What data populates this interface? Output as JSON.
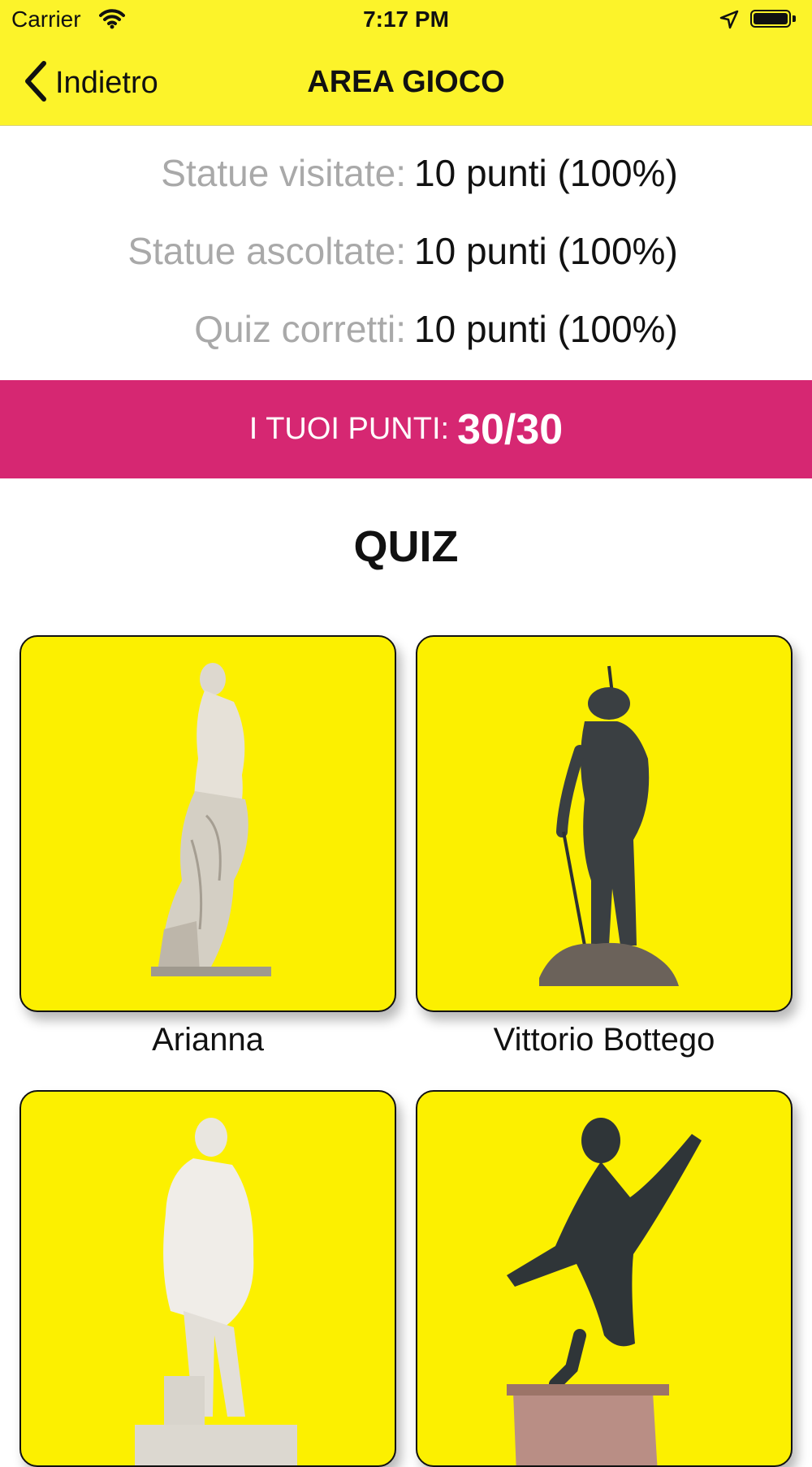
{
  "status_bar": {
    "carrier": "Carrier",
    "time": "7:17 PM"
  },
  "nav": {
    "back_label": "Indietro",
    "title": "AREA GIOCO"
  },
  "stats": [
    {
      "label": "Statue visitate:",
      "value": "10 punti (100%)"
    },
    {
      "label": "Statue ascoltate:",
      "value": "10 punti (100%)"
    },
    {
      "label": "Quiz corretti:",
      "value": "10 punti (100%)"
    }
  ],
  "score": {
    "label": "I TUOI PUNTI:",
    "value": "30/30"
  },
  "quiz": {
    "heading": "QUIZ",
    "cards": [
      {
        "name": "Arianna"
      },
      {
        "name": "Vittorio Bottego"
      },
      {
        "name": ""
      },
      {
        "name": ""
      }
    ]
  },
  "colors": {
    "header": "#fcf32a",
    "card": "#fcf000",
    "score_banner": "#d62772",
    "stat_label": "#a9a9a9"
  }
}
